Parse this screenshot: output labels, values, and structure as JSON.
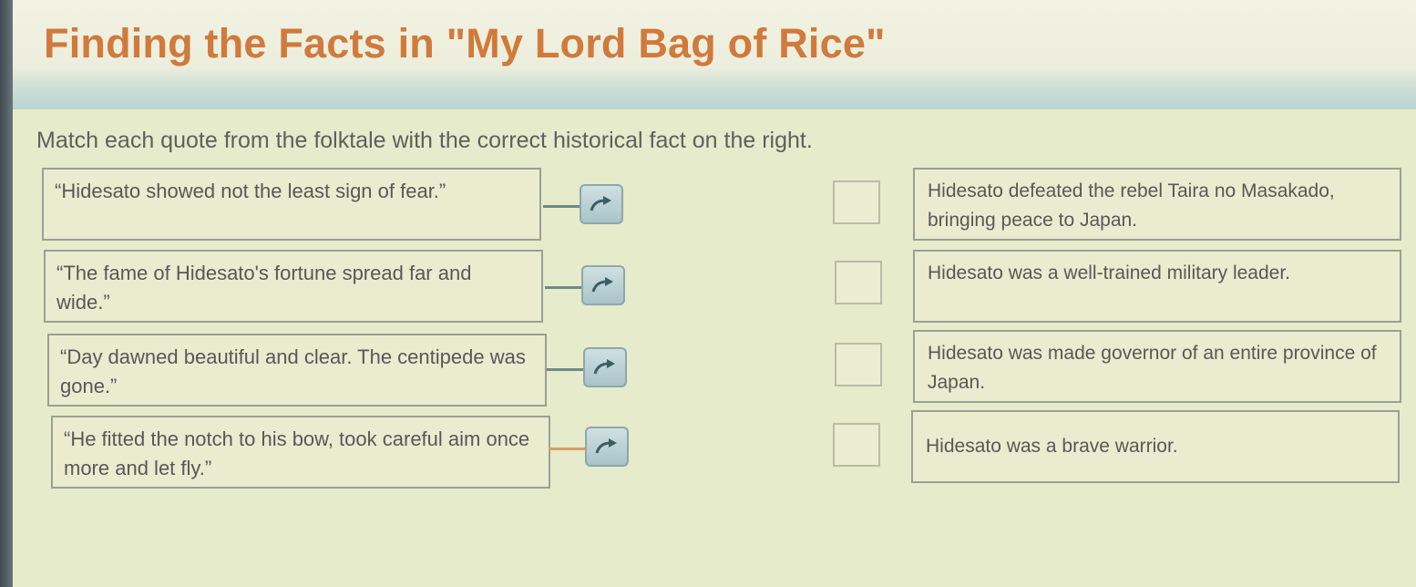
{
  "title": "Finding the Facts in \"My Lord Bag of Rice\"",
  "instructions": "Match each quote from the folktale with the correct historical fact on the right.",
  "quotes": [
    {
      "text": "“Hidesato showed not the least sign of fear.”"
    },
    {
      "text": "“The fame of Hidesato's fortune spread far and wide.”"
    },
    {
      "text": "“Day dawned beautiful and clear. The centipede was gone.”"
    },
    {
      "text": "“He fitted the notch to his bow, took careful aim once more and let fly.”"
    }
  ],
  "facts": [
    {
      "text": "Hidesato defeated the rebel Taira no Masakado, bringing peace to Japan."
    },
    {
      "text": "Hidesato was a well-trained military leader."
    },
    {
      "text": "Hidesato was made governor of an entire province of Japan."
    },
    {
      "text": "Hidesato was a brave warrior."
    }
  ],
  "drag_icon": "curved-arrow-icon",
  "colors": {
    "title": "#d07a3c",
    "background": "#e6ebcb",
    "text": "#585858",
    "handle": "#a9c4c9"
  }
}
